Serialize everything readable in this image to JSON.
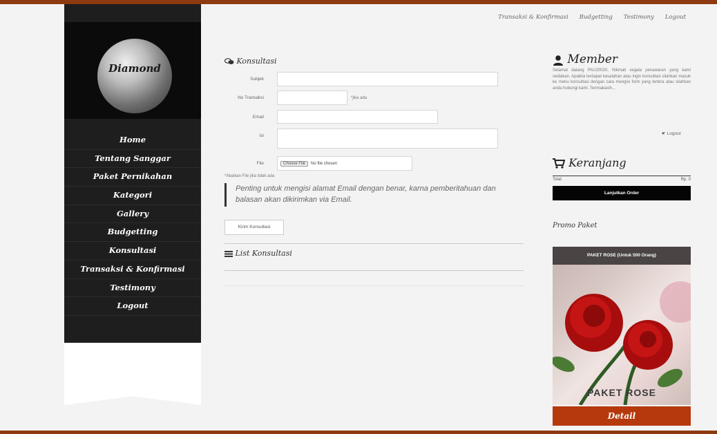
{
  "top_menu": {
    "items": [
      "Transaksi & Konfirmasi",
      "Budgetting",
      "Testimony",
      "Logout"
    ]
  },
  "sidebar": {
    "logo_text": "Diamond",
    "nav": [
      "Home",
      "Tentang Sanggar",
      "Paket Pernikahan",
      "Kategori",
      "Gallery",
      "Budgetting",
      "Konsultasi",
      "Transaksi & Konfirmasi",
      "Testimony",
      "Logout"
    ]
  },
  "konsultasi": {
    "title": "Konsultasi",
    "subjek_label": "Subjek",
    "no_transaksi_label": "No Transaksi",
    "no_transaksi_hint": "*jika ada",
    "email_label": "Email",
    "isi_label": "Isi",
    "file_label": "File",
    "file_button": "Choose File",
    "file_status": "No file chosen",
    "file_hint": "*Abaikan File jika tidak ada",
    "important_note": "Penting untuk mengisi alamat Email dengan benar, karna pemberitahuan dan balasan akan dikirimkan via Email.",
    "submit_label": "Kirim Konsultasi",
    "list_title": "List Konsultasi"
  },
  "member": {
    "title": "Member",
    "text": "Selamat datang PAU20020, Nikmati segala penawaran yang kami sediakan. Apabila terdapat kesalahan atau ingin konsultasi silahkan masuk ke menu konsultasi dengan cara mengisi form yang tertera atau silahkan anda hubungi kami. Terimakasih...",
    "logout_label": "Logout"
  },
  "cart": {
    "title": "Keranjang",
    "total_label": "Total",
    "total_value": "Rp. 0",
    "order_button": "Lanjutkan Order"
  },
  "promo": {
    "title": "Promo Paket",
    "card_header": "PAKET ROSE (Untuk 500 Orang)",
    "card_label": "PAKET ROSE",
    "detail_button": "Detail"
  },
  "colors": {
    "accent": "#b6390d",
    "topbar": "#8e3a10",
    "sidebar": "#1e1e1e"
  }
}
